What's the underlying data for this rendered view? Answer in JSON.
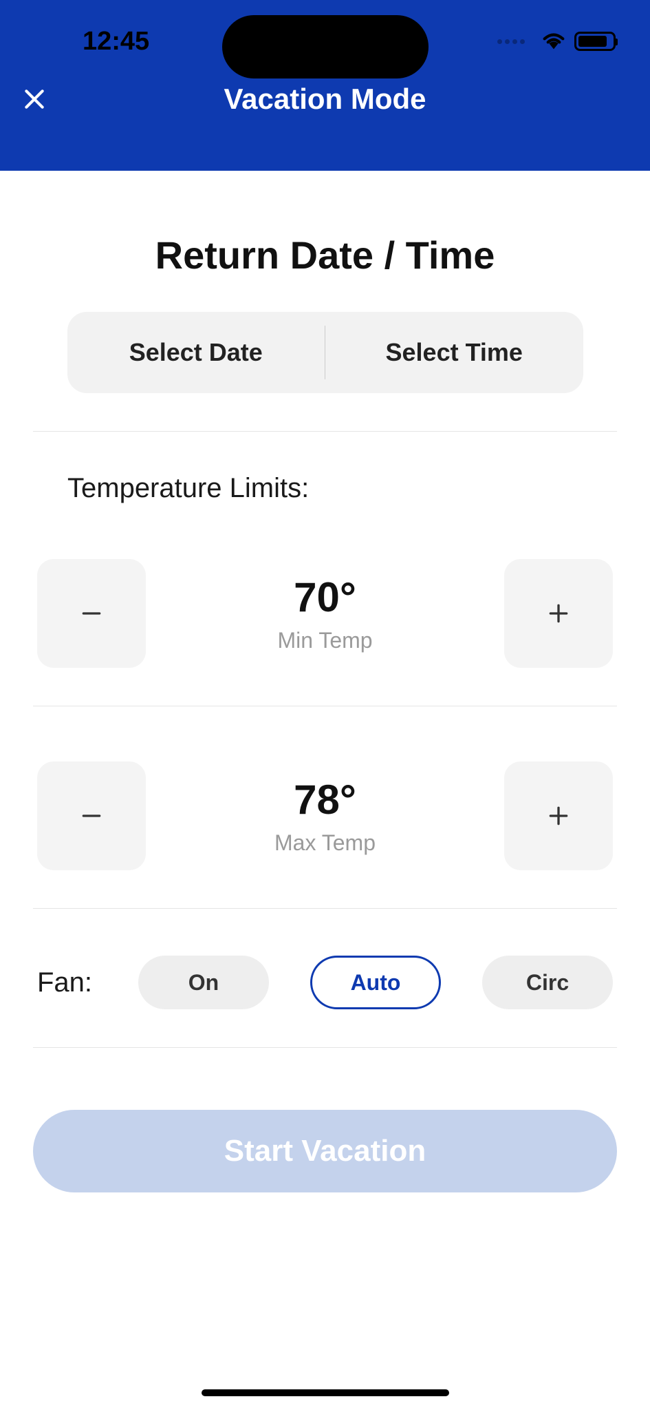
{
  "status": {
    "time": "12:45"
  },
  "nav": {
    "title": "Vacation Mode"
  },
  "return": {
    "heading": "Return Date / Time",
    "select_date": "Select Date",
    "select_time": "Select Time"
  },
  "temp": {
    "limits_label": "Temperature Limits:",
    "min_value": "70°",
    "min_label": "Min Temp",
    "max_value": "78°",
    "max_label": "Max Temp"
  },
  "fan": {
    "label": "Fan:",
    "options": {
      "on": "On",
      "auto": "Auto",
      "circ": "Circ"
    },
    "selected": "auto"
  },
  "cta": {
    "start": "Start Vacation"
  }
}
